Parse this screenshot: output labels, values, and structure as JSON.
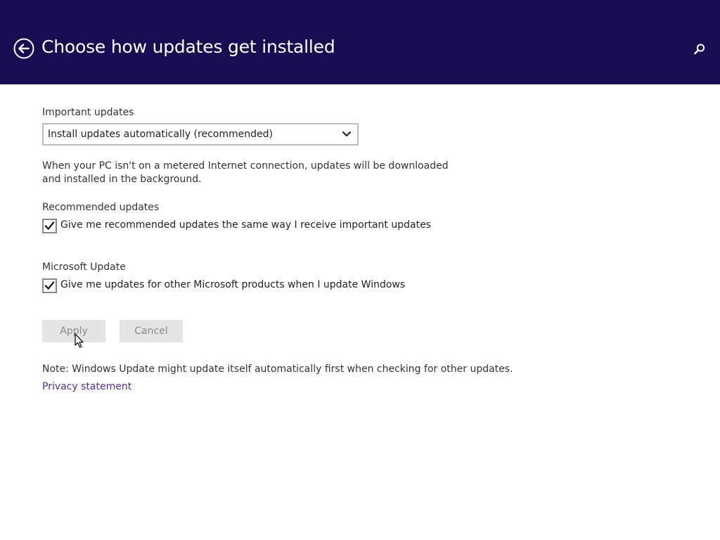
{
  "header": {
    "title": "Choose how updates get installed",
    "background_color": "#180d52",
    "back_icon": "back-arrow-circle-icon",
    "search_icon": "search-icon"
  },
  "important_updates": {
    "label": "Important updates",
    "selected_option": "Install updates automatically (recommended)",
    "description": "When your PC isn't on a metered Internet connection, updates will be downloaded and installed in the background."
  },
  "recommended_updates": {
    "label": "Recommended updates",
    "checkbox_label": "Give me recommended updates the same way I receive important updates",
    "checked": true
  },
  "microsoft_update": {
    "label": "Microsoft Update",
    "checkbox_label": "Give me updates for other Microsoft products when I update Windows",
    "checked": true
  },
  "buttons": {
    "apply": "Apply",
    "cancel": "Cancel"
  },
  "note": "Note: Windows Update might update itself automatically first when checking for other updates.",
  "privacy_link": "Privacy statement",
  "colors": {
    "link": "#4a2fa6",
    "button_bg": "#e5e5e5",
    "button_text_disabled": "#8a8a8a"
  }
}
